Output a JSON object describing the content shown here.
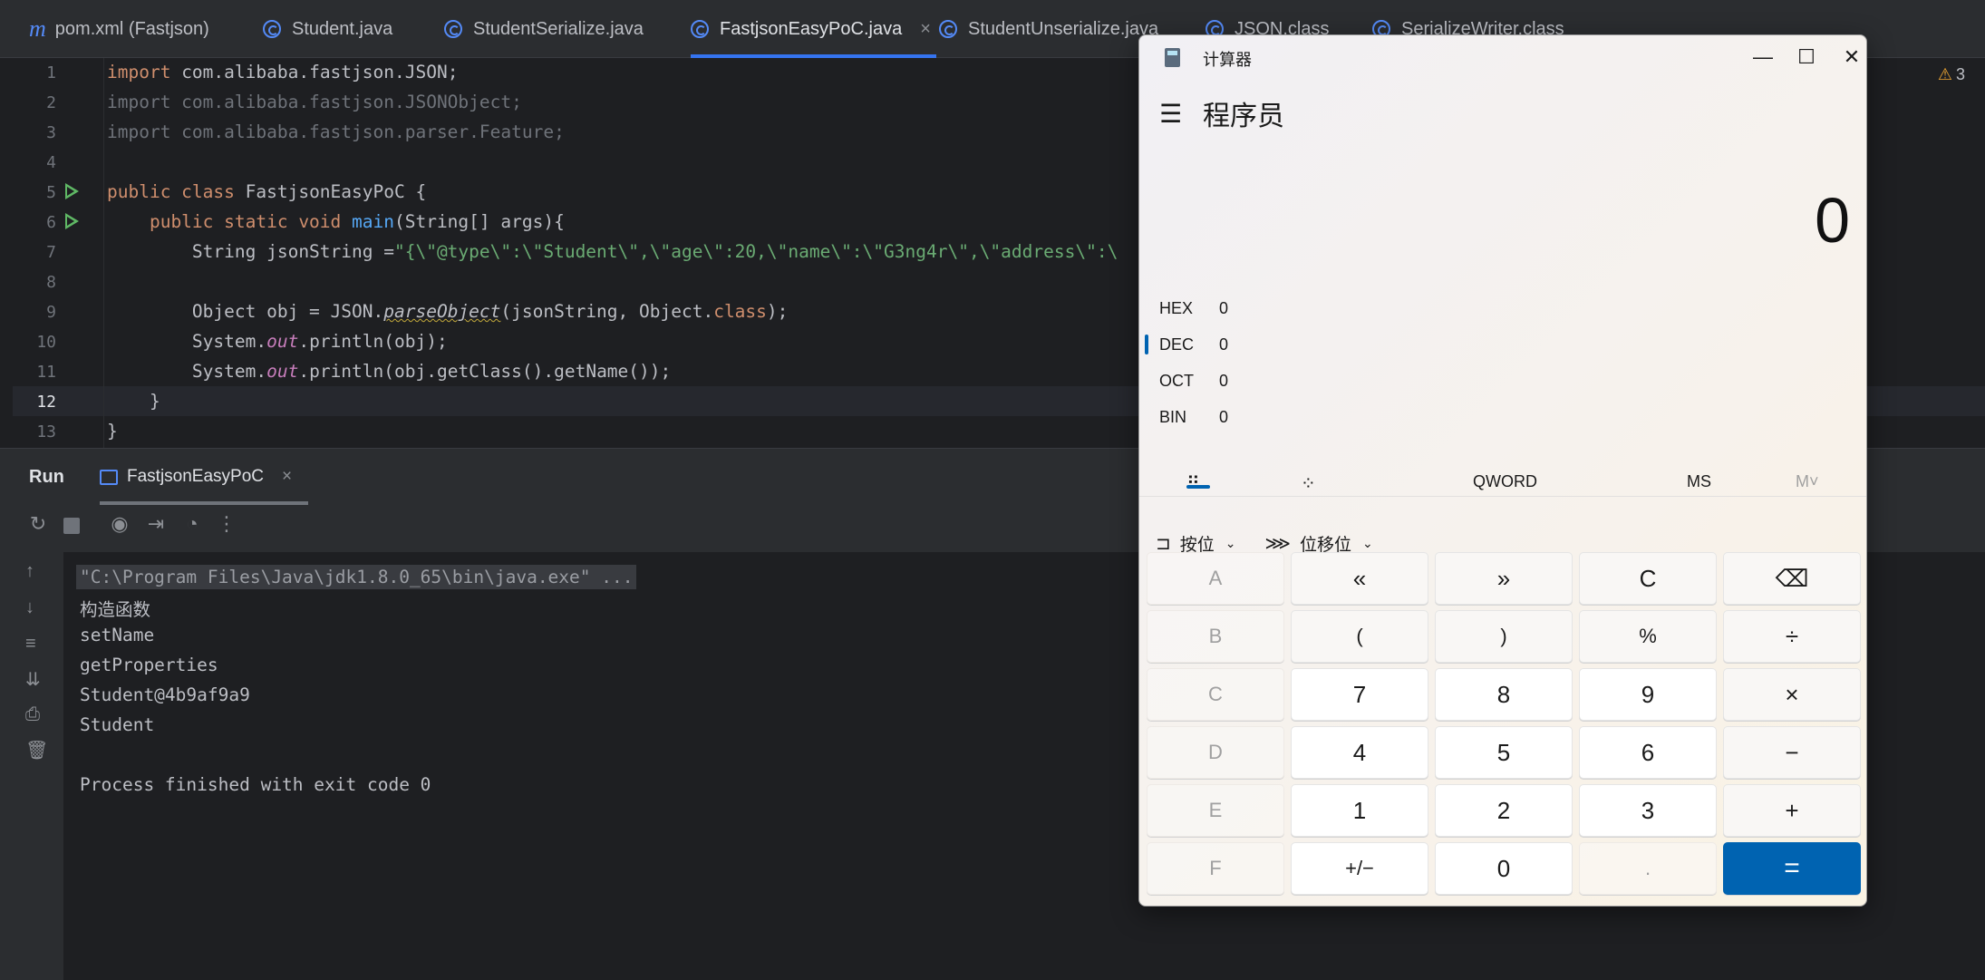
{
  "ide": {
    "tabs": [
      {
        "label": "pom.xml (Fastjson)",
        "icon": "maven-icon"
      },
      {
        "label": "Student.java",
        "icon": "class-icon"
      },
      {
        "label": "StudentSerialize.java",
        "icon": "class-icon"
      },
      {
        "label": "FastjsonEasyPoC.java",
        "icon": "class-icon",
        "close": "×"
      },
      {
        "label": "StudentUnserialize.java",
        "icon": "class-icon"
      },
      {
        "label": "JSON.class",
        "icon": "class-icon"
      },
      {
        "label": "SerializeWriter.class",
        "icon": "class-icon"
      }
    ],
    "warnings_count": "3",
    "line_numbers": [
      "1",
      "2",
      "3",
      "4",
      "5",
      "6",
      "7",
      "8",
      "9",
      "10",
      "11",
      "12",
      "13"
    ],
    "code": {
      "l1_kw": "import",
      "l1_rest": " com.alibaba.fastjson.JSON;",
      "l2": "import com.alibaba.fastjson.JSONObject;",
      "l3": "import com.alibaba.fastjson.parser.Feature;",
      "l5_kw": "public class",
      "l5_rest": " FastjsonEasyPoC {",
      "l6_kw": "    public static void",
      "l6_m": " main",
      "l6_rest": "(String[] args){",
      "l7_a": "        String jsonString =",
      "l7_s": "\"{\\\"@type\\\":\\\"Student\\\",\\\"age\\\":20,\\\"name\\\":\\\"G3ng4r\\\",\\\"address\\\":\\",
      "l9_a": "        Object obj = JSON.",
      "l9_m": "parseObject",
      "l9_b": "(jsonString, Object.",
      "l9_k": "class",
      "l9_c": ");",
      "l10_a": "        System.",
      "l10_it": "out",
      "l10_b": ".println(obj);",
      "l11_a": "        System.",
      "l11_it": "out",
      "l11_b": ".println(obj.getClass().getName());",
      "l12": "    }",
      "l13": "}"
    }
  },
  "run_panel": {
    "label": "Run",
    "tab_label": "FastjsonEasyPoC",
    "tab_close": "×",
    "output": [
      "\"C:\\Program Files\\Java\\jdk1.8.0_65\\bin\\java.exe\" ...",
      "构造函数",
      "setName",
      "getProperties",
      "Student@4b9af9a9",
      "Student",
      "",
      "Process finished with exit code 0"
    ]
  },
  "calculator": {
    "title": "计算器",
    "mode": "程序员",
    "display": "0",
    "radix": [
      {
        "label": "HEX",
        "value": "0"
      },
      {
        "label": "DEC",
        "value": "0"
      },
      {
        "label": "OCT",
        "value": "0"
      },
      {
        "label": "BIN",
        "value": "0"
      }
    ],
    "word_size": "QWORD",
    "ms": "MS",
    "mv": "M˅",
    "bitwise": "按位",
    "bitshift": "位移位",
    "keys": [
      [
        "A",
        "«",
        "»",
        "C",
        "⌫"
      ],
      [
        "B",
        "(",
        ")",
        "%",
        "÷"
      ],
      [
        "C",
        "7",
        "8",
        "9",
        "×"
      ],
      [
        "D",
        "4",
        "5",
        "6",
        "−"
      ],
      [
        "E",
        "1",
        "2",
        "3",
        "+"
      ],
      [
        "F",
        "+/−",
        "0",
        ".",
        "="
      ]
    ],
    "accent": "#0063b1"
  }
}
